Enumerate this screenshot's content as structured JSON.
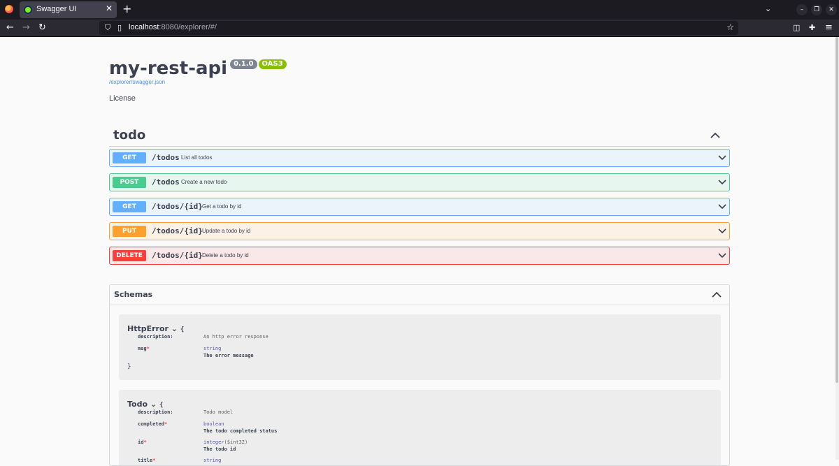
{
  "browser": {
    "tab_title": "Swagger UI",
    "tab_close": "✕",
    "new_tab": "+",
    "url_host": "localhost",
    "url_rest": ":8080/explorer/#/"
  },
  "api": {
    "title": "my-rest-api",
    "version": "0.1.0",
    "oas_badge": "OAS3",
    "spec_link": "/explorer/swagger.json",
    "license": "License"
  },
  "tag": {
    "name": "todo",
    "operations": [
      {
        "method": "GET",
        "path": "/todos",
        "summary": "List all todos"
      },
      {
        "method": "POST",
        "path": "/todos",
        "summary": "Create a new todo"
      },
      {
        "method": "GET",
        "path": "/todos/{id}",
        "summary": "Get a todo by id"
      },
      {
        "method": "PUT",
        "path": "/todos/{id}",
        "summary": "Update a todo by id"
      },
      {
        "method": "DELETE",
        "path": "/todos/{id}",
        "summary": "Delete a todo by id"
      }
    ]
  },
  "schemas": {
    "title": "Schemas",
    "models": [
      {
        "name": "HttpError",
        "brace_open": "{",
        "brace_close": "}",
        "description_label": "description:",
        "description": "An http error response",
        "properties": [
          {
            "name": "msg",
            "required": "*",
            "type": "string",
            "description": "The error message"
          }
        ]
      },
      {
        "name": "Todo",
        "brace_open": "{",
        "description_label": "description:",
        "description": "Todo model",
        "properties": [
          {
            "name": "completed",
            "required": "*",
            "type": "boolean",
            "description": "The todo completed status"
          },
          {
            "name": "id",
            "required": "*",
            "type": "integer",
            "format": "($int32)",
            "description": "The todo id"
          },
          {
            "name": "title",
            "required": "*",
            "type": "string"
          }
        ]
      }
    ]
  },
  "colors": {
    "get": "#61affe",
    "post": "#49cc90",
    "put": "#fca130",
    "delete": "#f93e3e",
    "oas": "#89bf04"
  }
}
